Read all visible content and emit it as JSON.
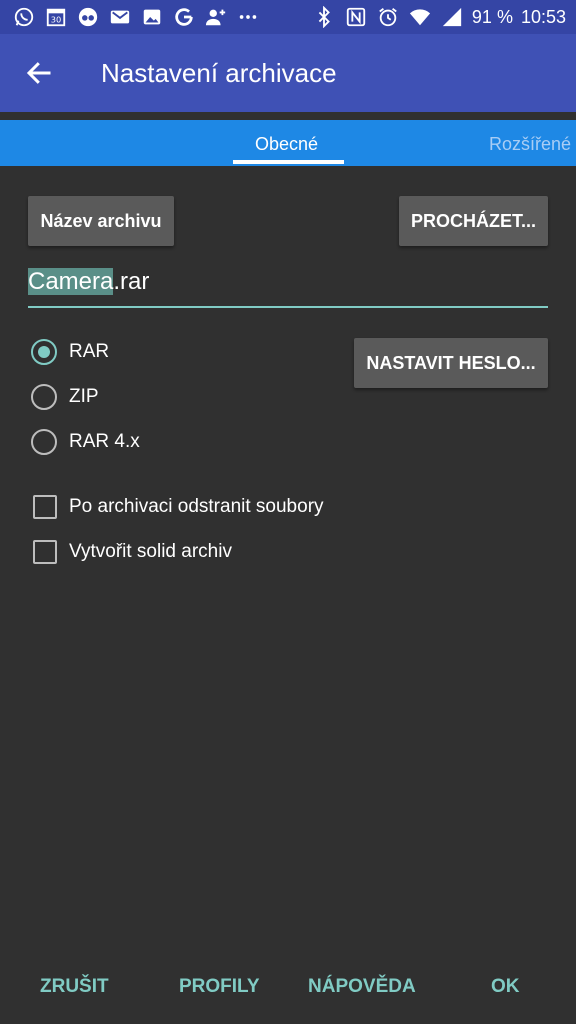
{
  "status_bar": {
    "battery": "91 %",
    "time": "10:53",
    "calendar_day": "30"
  },
  "app_bar": {
    "title": "Nastavení archivace"
  },
  "tabs": [
    {
      "label": "Obecné"
    },
    {
      "label": "Rozšířené"
    }
  ],
  "general": {
    "archive_name_button": "Název archivu",
    "browse_button": "PROCHÁZET...",
    "archive_name_selected": "Camera",
    "archive_name_rest": ".rar",
    "set_password_button": "NASTAVIT HESLO...",
    "formats": [
      {
        "label": "RAR",
        "checked": true
      },
      {
        "label": "ZIP",
        "checked": false
      },
      {
        "label": "RAR 4.x",
        "checked": false
      }
    ],
    "options": [
      {
        "label": "Po archivaci odstranit soubory",
        "checked": false
      },
      {
        "label": "Vytvořit solid archiv",
        "checked": false
      }
    ]
  },
  "actions": {
    "cancel": "ZRUŠIT",
    "profiles": "PROFILY",
    "help": "NÁPOVĚDA",
    "ok": "OK"
  },
  "colors": {
    "accent": "#80cbc4",
    "app_bar": "#3f51b5",
    "tab_bar": "#1e88e5",
    "background": "#303030"
  }
}
